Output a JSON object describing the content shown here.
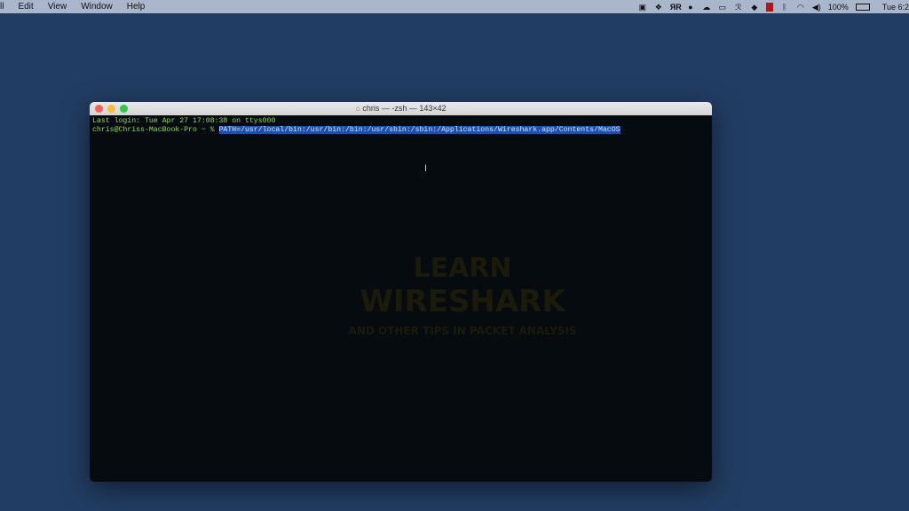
{
  "menubar": {
    "items": [
      "ll",
      "Edit",
      "View",
      "Window",
      "Help"
    ],
    "status": {
      "battery": "100%",
      "clock": "Tue 6:2"
    },
    "status_icons": [
      "zoom-icon",
      "dropbox-icon",
      "sr-icon",
      "dollar-icon",
      "cloud-icon",
      "screen-icon",
      "scribble-icon",
      "cube-icon",
      "red-box-icon",
      "bluetooth-icon",
      "wifi-icon",
      "volume-icon",
      "battery-icon"
    ]
  },
  "window": {
    "title": "chris — -zsh — 143×42",
    "lines": {
      "login": "Last login: Tue Apr 27 17:08:38 on ttys000",
      "prompt": "chris@Chriss-MacBook-Pro ~ % ",
      "command": "PATH=/usr/local/bin:/usr/bin:/bin:/usr/sbin:/sbin:/Applications/Wireshark.app/Contents/MacOS"
    }
  },
  "watermark": {
    "line1": "LEARN",
    "line2": "WIRESHARK",
    "line3": "AND OTHER TIPS IN PACKET ANALYSIS"
  }
}
